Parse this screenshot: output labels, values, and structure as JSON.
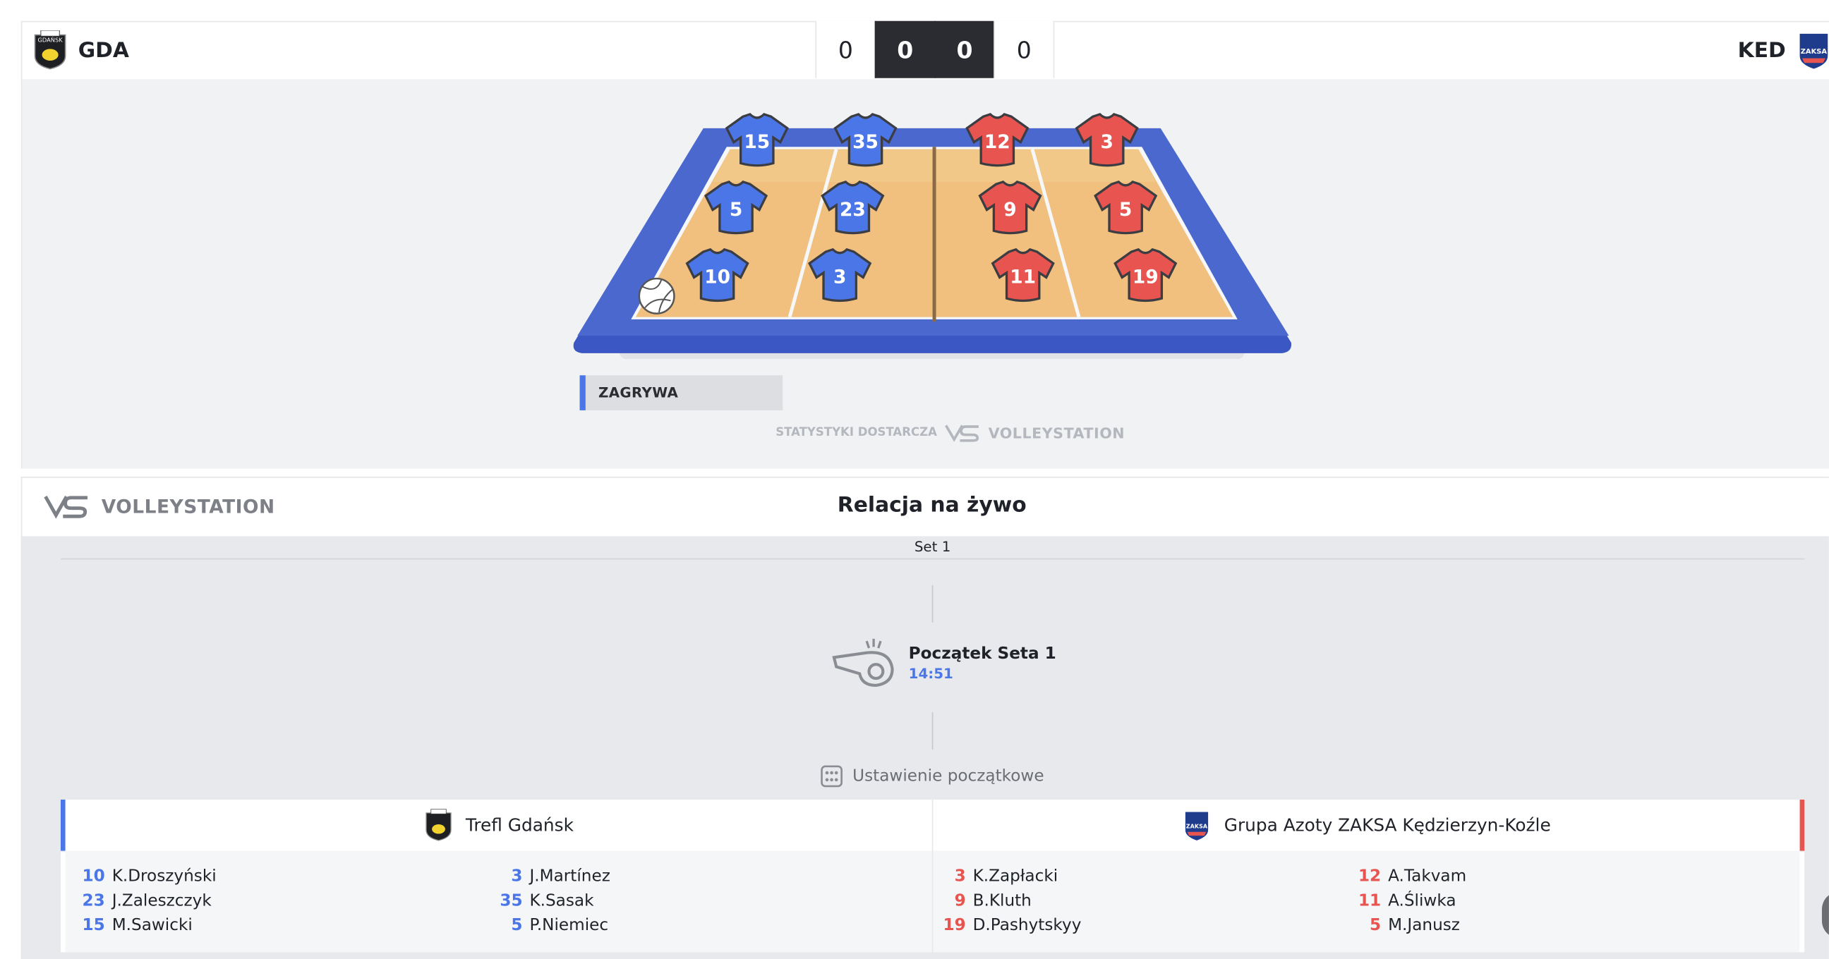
{
  "header": {
    "home_code": "GDA",
    "away_code": "KED",
    "home_sets": "0",
    "home_points": "0",
    "away_points": "0",
    "away_sets": "0"
  },
  "court": {
    "home_players": [
      "15",
      "35",
      "5",
      "23",
      "10",
      "3"
    ],
    "away_players": [
      "12",
      "3",
      "9",
      "5",
      "11",
      "19"
    ],
    "home_color": "#4a76e8",
    "away_color": "#e8544f",
    "serve_label": "ZAGRYWA",
    "provided_by_label": "STATYSTYKI DOSTARCZA",
    "provider_brand": "VOLLEYSTATION"
  },
  "live": {
    "brand": "VOLLEYSTATION",
    "title": "Relacja na żywo",
    "set_label": "Set 1",
    "event_title": "Początek Seta 1",
    "event_time": "14:51",
    "lineup_label": "Ustawienie początkowe",
    "home_team_name": "Trefl Gdańsk",
    "away_team_name": "Grupa Azoty ZAKSA Kędzierzyn-Koźle",
    "home_col1": [
      {
        "num": "10",
        "name": "K.Droszyński"
      },
      {
        "num": "23",
        "name": "J.Zaleszczyk"
      },
      {
        "num": "15",
        "name": "M.Sawicki"
      }
    ],
    "home_col2": [
      {
        "num": "3",
        "name": "J.Martínez"
      },
      {
        "num": "35",
        "name": "K.Sasak"
      },
      {
        "num": "5",
        "name": "P.Niemiec"
      }
    ],
    "away_col1": [
      {
        "num": "3",
        "name": "K.Zapłacki"
      },
      {
        "num": "9",
        "name": "B.Kluth"
      },
      {
        "num": "19",
        "name": "D.Pashytskyy"
      }
    ],
    "away_col2": [
      {
        "num": "12",
        "name": "A.Takvam"
      },
      {
        "num": "11",
        "name": "A.Śliwka"
      },
      {
        "num": "5",
        "name": "M.Janusz"
      }
    ]
  }
}
